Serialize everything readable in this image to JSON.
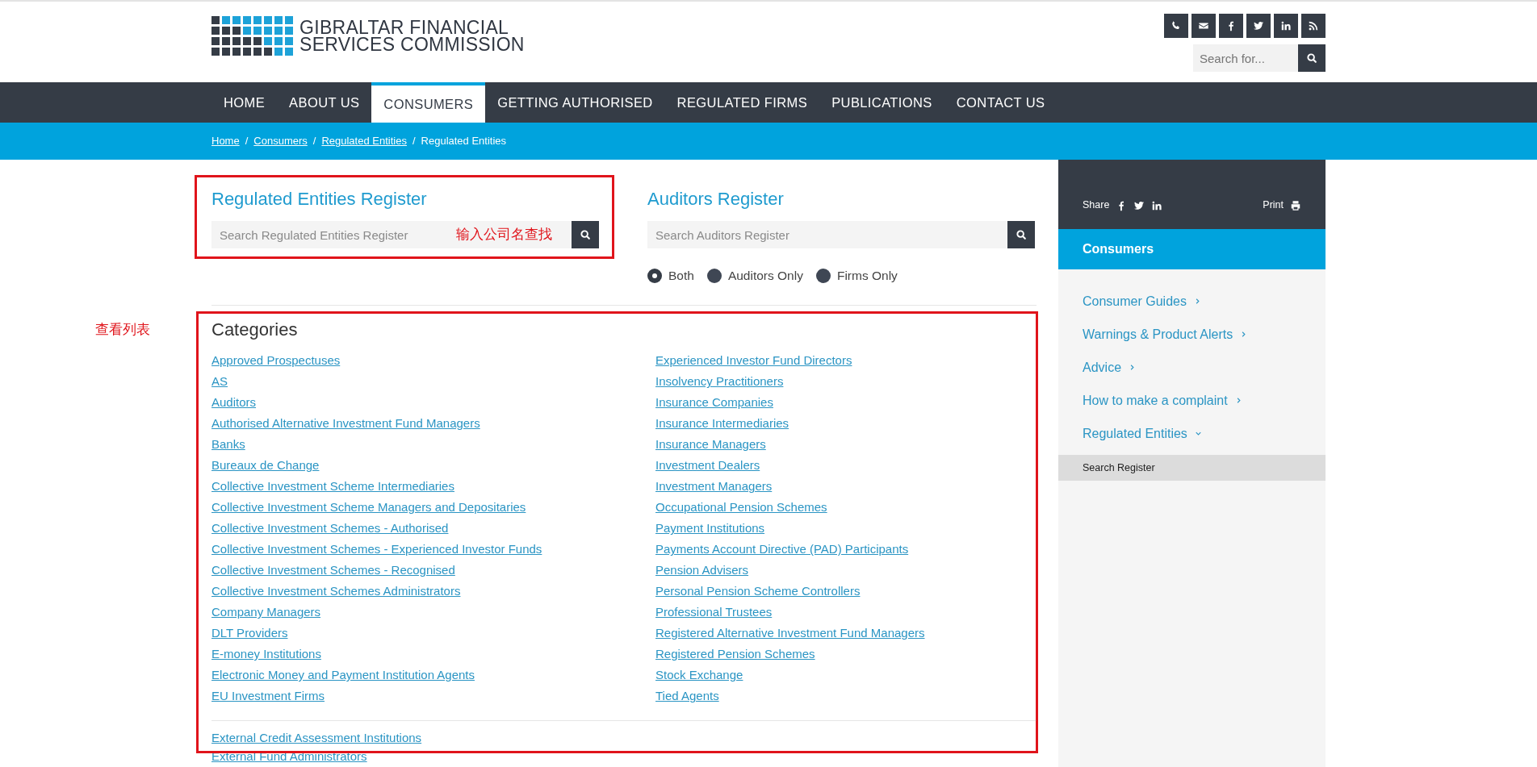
{
  "header": {
    "logo_lines": [
      "GIBRALTAR FINANCIAL",
      "SERVICES COMMISSION"
    ],
    "search": {
      "placeholder": "Search for..."
    }
  },
  "nav": [
    {
      "label": "HOME",
      "selected": false
    },
    {
      "label": "ABOUT US",
      "selected": false
    },
    {
      "label": "CONSUMERS",
      "selected": true
    },
    {
      "label": "GETTING AUTHORISED",
      "selected": false
    },
    {
      "label": "REGULATED FIRMS",
      "selected": false
    },
    {
      "label": "PUBLICATIONS",
      "selected": false
    },
    {
      "label": "CONTACT US",
      "selected": false
    }
  ],
  "breadcrumb": [
    {
      "label": "Home",
      "current": false,
      "separator": "/"
    },
    {
      "label": "Consumers",
      "current": false,
      "separator": "/"
    },
    {
      "label": "Regulated Entities",
      "current": false,
      "separator": "/"
    },
    {
      "label": "Regulated Entities",
      "current": true
    }
  ],
  "registers": [
    {
      "title": "Regulated Entities Register",
      "placeholder": "Search Regulated Entities Register"
    },
    {
      "title": "Auditors Register",
      "placeholder": "Search Auditors Register"
    }
  ],
  "register_filter": [
    {
      "label": "Both",
      "selected": true
    },
    {
      "label": "Auditors Only",
      "selected": false
    },
    {
      "label": "Firms Only",
      "selected": false
    }
  ],
  "categories": {
    "title": "Categories",
    "columns": [
      [
        "Approved Prospectuses",
        "AS",
        "Auditors",
        "Authorised Alternative Investment Fund Managers",
        "Banks",
        "Bureaux de Change",
        "Collective Investment Scheme Intermediaries",
        "Collective Investment Scheme Managers and Depositaries",
        "Collective Investment Schemes - Authorised",
        "Collective Investment Schemes - Experienced Investor Funds",
        "Collective Investment Schemes - Recognised",
        "Collective Investment Schemes Administrators",
        "Company Managers",
        "DLT Providers",
        "E-money Institutions",
        "Electronic Money and Payment Institution Agents",
        "EU Investment Firms"
      ],
      [
        "Experienced Investor Fund Directors",
        "Insolvency Practitioners",
        "Insurance Companies",
        "Insurance Intermediaries",
        "Insurance Managers",
        "Investment Dealers",
        "Investment Managers",
        "Occupational Pension Schemes",
        "Payment Institutions",
        "Payments Account Directive (PAD) Participants",
        "Pension Advisers",
        "Personal Pension Scheme Controllers",
        "Professional Trustees",
        "Registered Alternative Investment Fund Managers",
        "Registered Pension Schemes",
        "Stock Exchange",
        "Tied Agents"
      ]
    ],
    "more": [
      "External Credit Assessment Institutions",
      "External Fund Administrators"
    ]
  },
  "sidebar": {
    "share_label": "Share",
    "print_label": "Print",
    "heading": "Consumers",
    "items": [
      {
        "label": "Consumer Guides",
        "expanded": false
      },
      {
        "label": "Warnings & Product Alerts",
        "expanded": false
      },
      {
        "label": "Advice",
        "expanded": false
      },
      {
        "label": "How to make a complaint",
        "expanded": false
      },
      {
        "label": "Regulated Entities",
        "expanded": true,
        "children": [
          {
            "label": "Search Register",
            "selected": true
          }
        ]
      }
    ]
  },
  "annotations": [
    {
      "text": "输入公司名查找"
    },
    {
      "text": "查看列表"
    }
  ]
}
